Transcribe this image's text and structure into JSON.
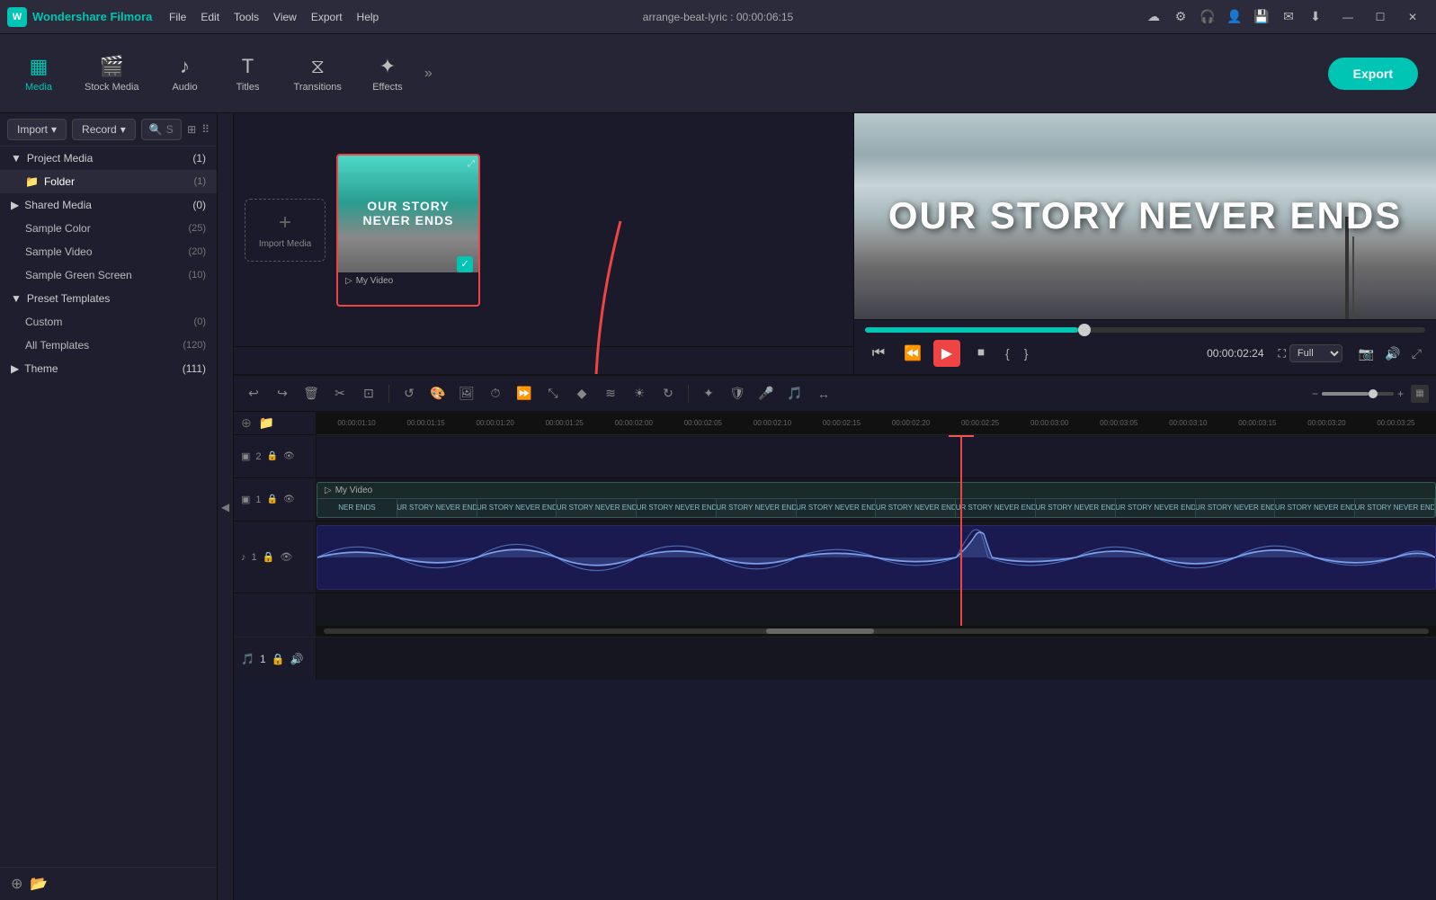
{
  "app": {
    "name": "Wondershare Filmora",
    "logo_icon": "W",
    "title": "arrange-beat-lyric : 00:00:06:15"
  },
  "titlebar": {
    "menu": [
      "File",
      "Edit",
      "Tools",
      "View",
      "Export",
      "Help"
    ],
    "window_controls": [
      "—",
      "☐",
      "✕"
    ]
  },
  "toolbar": {
    "items": [
      {
        "id": "media",
        "label": "Media",
        "icon": "▦",
        "active": true
      },
      {
        "id": "stock",
        "label": "Stock Media",
        "icon": "🎬"
      },
      {
        "id": "audio",
        "label": "Audio",
        "icon": "♪"
      },
      {
        "id": "titles",
        "label": "Titles",
        "icon": "T"
      },
      {
        "id": "transitions",
        "label": "Transitions",
        "icon": "⧖"
      },
      {
        "id": "effects",
        "label": "Effects",
        "icon": "✦"
      }
    ],
    "export_label": "Export"
  },
  "left_panel": {
    "import_label": "Import",
    "record_label": "Record",
    "search_placeholder": "Search media",
    "tree": [
      {
        "label": "Project Media",
        "count": "(1)",
        "expanded": true,
        "indent": 0,
        "section": true
      },
      {
        "label": "Folder",
        "count": "(1)",
        "indent": 1,
        "selected": true
      },
      {
        "label": "Shared Media",
        "count": "(0)",
        "indent": 0,
        "section": true
      },
      {
        "label": "Sample Color",
        "count": "(25)",
        "indent": 1
      },
      {
        "label": "Sample Video",
        "count": "(20)",
        "indent": 1
      },
      {
        "label": "Sample Green Screen",
        "count": "(10)",
        "indent": 1
      },
      {
        "label": "Preset Templates",
        "count": "",
        "indent": 0,
        "section": true,
        "expanded": true
      },
      {
        "label": "Custom",
        "count": "(0)",
        "indent": 1
      },
      {
        "label": "All Templates",
        "count": "(120)",
        "indent": 1
      },
      {
        "label": "Theme",
        "count": "(111)",
        "indent": 0,
        "section": true
      }
    ]
  },
  "media_grid": {
    "import_label": "Import Media",
    "thumb": {
      "title_line1": "OUR STORY",
      "title_line2": "NEVER ENDS",
      "name": "My Video"
    }
  },
  "preview": {
    "title": "OUR STORY NEVER ENDS",
    "progress_percent": 38,
    "time_display": "00:00:02:24",
    "zoom_level": "Full"
  },
  "timeline": {
    "ruler_marks": [
      "00:00:01:10",
      "00:00:01:15",
      "00:00:01:20",
      "00:00:01:25",
      "00:00:02:00",
      "00:00:02:05",
      "00:00:02:10",
      "00:00:02:15",
      "00:00:02:20",
      "00:00:02:25",
      "00:00:03:00",
      "00:00:03:05",
      "00:00:03:10",
      "00:00:03:15",
      "00:00:03:20",
      "00:00:03:25"
    ],
    "video_clip": {
      "name": "My Video",
      "segments": [
        "NER ENDS",
        "OUR STORY NEVER ENDS",
        "OUR STORY NEVER ENDS",
        "OUR STORY NEVER ENDS",
        "OUR STORY NEVER ENDS",
        "OUR STORY NEVER ENDS",
        "OUR STORY NEVER ENDS",
        "OUR STORY NEVER ENDS",
        "OUR STORY NEVER ENDS",
        "OUR STORY NEVER ENDS",
        "OUR STORY NEVER ENDS",
        "OUR STORY NEVER ENDS",
        "OUR STORY NEVER ENDS",
        "OUR STORY NEVER ENDS"
      ]
    },
    "track_labels": [
      {
        "id": "v2",
        "icon": "▣",
        "number": "2"
      },
      {
        "id": "v1",
        "icon": "▣",
        "number": "1"
      },
      {
        "id": "m1",
        "icon": "♪",
        "number": "1"
      }
    ]
  }
}
